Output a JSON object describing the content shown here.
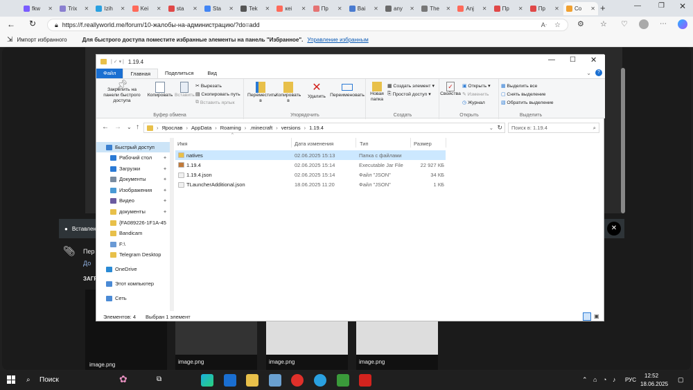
{
  "browser": {
    "tabs": [
      {
        "label": "fkw",
        "color": "#7a5cff"
      },
      {
        "label": "Trix",
        "color": "#8a7fd0"
      },
      {
        "label": "Izih",
        "color": "#2aa0e0"
      },
      {
        "label": "Kei",
        "color": "#ff6a5a"
      },
      {
        "label": "sta",
        "color": "#e04848"
      },
      {
        "label": "Sta",
        "color": "#4285f4"
      },
      {
        "label": "Tek",
        "color": "#555555"
      },
      {
        "label": "кеі",
        "color": "#ff6a5a"
      },
      {
        "label": "Пр",
        "color": "#e57373"
      },
      {
        "label": "Ваі",
        "color": "#4a7bd0"
      },
      {
        "label": "any",
        "color": "#6a6a6a"
      },
      {
        "label": "The",
        "color": "#777777"
      },
      {
        "label": "Anj",
        "color": "#ff6a5a"
      },
      {
        "label": "Пр",
        "color": "#e04848"
      },
      {
        "label": "Пр",
        "color": "#e04848"
      },
      {
        "label": "Co",
        "color": "#f0a030"
      }
    ],
    "url": "https://f.reallyworld.me/forum/10-жалобы-на-администрацию/?do=add",
    "favbar": {
      "import": "Импорт избранного",
      "hint": "Для быстрого доступа поместите избранные элементы на панель \"Избранное\".",
      "manage_link": "Управление избранным"
    }
  },
  "page_bg": {
    "notice": "Вставлен",
    "attach_label": "Пер",
    "attach_sub": "До",
    "upload_heading": "ЗАГР",
    "thumb_name": "image.png",
    "thumbs": [
      "image.png",
      "image.png",
      "image.png",
      "image.png"
    ]
  },
  "explorer": {
    "title": "1.19.4",
    "tabs": [
      "Файл",
      "Главная",
      "Поделиться",
      "Вид"
    ],
    "ribbon": {
      "pin": "Закрепить на панели быстрого доступа",
      "copy": "Копировать",
      "paste": "Вставить",
      "cut": "Вырезать",
      "copy_path": "Скопировать путь",
      "paste_shortcut": "Вставить ярлык",
      "clipboard_group": "Буфер обмена",
      "move": "Переместить в",
      "copy_to": "Копировать в",
      "delete": "Удалить",
      "rename": "Переименовать",
      "organize_group": "Упорядочить",
      "new_folder": "Новая папка",
      "new_item": "Создать элемент",
      "easy_access": "Простой доступ",
      "create_group": "Создать",
      "properties": "Свойства",
      "open": "Открыть",
      "edit": "Изменить",
      "history": "Журнал",
      "open_group": "Открыть",
      "select_all": "Выделить все",
      "select_none": "Снять выделение",
      "invert": "Обратить выделение",
      "select_group": "Выделить"
    },
    "breadcrumb": [
      "Ярослав",
      "AppData",
      "Roaming",
      ".minecraft",
      "versions",
      "1.19.4"
    ],
    "search_placeholder": "Поиск в: 1.19.4",
    "nav": [
      {
        "label": "Быстрый доступ",
        "color": "#3a80d0",
        "pin": false
      },
      {
        "label": "Рабочий стол",
        "color": "#2a7ad5",
        "pin": true
      },
      {
        "label": "Загрузки",
        "color": "#2a7ad5",
        "pin": true
      },
      {
        "label": "Документы",
        "color": "#7a8ca0",
        "pin": true
      },
      {
        "label": "Изображения",
        "color": "#4a9ad5",
        "pin": true
      },
      {
        "label": "Видео",
        "color": "#6a5aa0",
        "pin": true
      },
      {
        "label": "документы",
        "color": "#e8c04a",
        "pin": true
      },
      {
        "label": "{FA089226-1F1A-45",
        "color": "#e8c04a",
        "pin": false
      },
      {
        "label": "Bandicam",
        "color": "#e8c04a",
        "pin": false
      },
      {
        "label": "F:\\",
        "color": "#6a9ad5",
        "pin": false
      },
      {
        "label": "Telegram Desktop",
        "color": "#e8c04a",
        "pin": false
      },
      {
        "label": "OneDrive",
        "color": "#2a8ad5",
        "pin": false
      },
      {
        "label": "Этот компьютер",
        "color": "#4a8ad5",
        "pin": false
      },
      {
        "label": "Сеть",
        "color": "#4a8ad5",
        "pin": false
      }
    ],
    "columns": [
      "Имя",
      "Дата изменения",
      "Тип",
      "Размер"
    ],
    "files": [
      {
        "name": "natives",
        "date": "02.06.2025 15:13",
        "type": "Папка с файлами",
        "size": "",
        "color": "#e8c04a",
        "selected": true
      },
      {
        "name": "1.19.4",
        "date": "02.06.2025 15:14",
        "type": "Executable Jar File",
        "size": "22 927 КБ",
        "color": "#c07a3a",
        "selected": false
      },
      {
        "name": "1.19.4.json",
        "date": "02.06.2025 15:14",
        "type": "Файл \"JSON\"",
        "size": "34 КБ",
        "color": "#f0f0f0",
        "selected": false
      },
      {
        "name": "TLauncherAdditional.json",
        "date": "18.06.2025 11:20",
        "type": "Файл \"JSON\"",
        "size": "1 КБ",
        "color": "#f0f0f0",
        "selected": false
      }
    ],
    "status_count": "Элементов: 4",
    "status_selected": "Выбран 1 элемент"
  },
  "taskbar": {
    "search": "Поиск",
    "lang": "РУС",
    "time": "12:52",
    "date": "18.06.2025"
  }
}
